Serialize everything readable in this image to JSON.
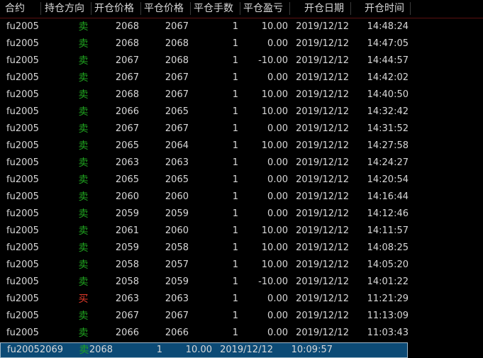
{
  "colors": {
    "background": "#000000",
    "sell": "#1fa51f",
    "buy": "#e23a2a",
    "selected_row": "#0c4a75",
    "text": "#d8d8d8"
  },
  "headers": {
    "contract": "合约",
    "direction": "持仓方向",
    "open_price": "开仓价格",
    "close_price": "平仓价格",
    "close_qty": "平仓手数",
    "close_pl": "平仓盈亏",
    "open_date": "开仓日期",
    "open_time": "开仓时间"
  },
  "rows": [
    {
      "contract": "fu2005",
      "direction": "卖",
      "side": "sell",
      "open_price": "2068",
      "close_price": "2067",
      "qty": "1",
      "pl": "10.00",
      "date": "2019/12/12",
      "time": "14:48:24"
    },
    {
      "contract": "fu2005",
      "direction": "卖",
      "side": "sell",
      "open_price": "2068",
      "close_price": "2068",
      "qty": "1",
      "pl": "0.00",
      "date": "2019/12/12",
      "time": "14:47:05"
    },
    {
      "contract": "fu2005",
      "direction": "卖",
      "side": "sell",
      "open_price": "2067",
      "close_price": "2068",
      "qty": "1",
      "pl": "-10.00",
      "date": "2019/12/12",
      "time": "14:44:57"
    },
    {
      "contract": "fu2005",
      "direction": "卖",
      "side": "sell",
      "open_price": "2067",
      "close_price": "2067",
      "qty": "1",
      "pl": "0.00",
      "date": "2019/12/12",
      "time": "14:42:02"
    },
    {
      "contract": "fu2005",
      "direction": "卖",
      "side": "sell",
      "open_price": "2068",
      "close_price": "2067",
      "qty": "1",
      "pl": "10.00",
      "date": "2019/12/12",
      "time": "14:40:50"
    },
    {
      "contract": "fu2005",
      "direction": "卖",
      "side": "sell",
      "open_price": "2066",
      "close_price": "2065",
      "qty": "1",
      "pl": "10.00",
      "date": "2019/12/12",
      "time": "14:32:42"
    },
    {
      "contract": "fu2005",
      "direction": "卖",
      "side": "sell",
      "open_price": "2067",
      "close_price": "2067",
      "qty": "1",
      "pl": "0.00",
      "date": "2019/12/12",
      "time": "14:31:52"
    },
    {
      "contract": "fu2005",
      "direction": "卖",
      "side": "sell",
      "open_price": "2065",
      "close_price": "2064",
      "qty": "1",
      "pl": "10.00",
      "date": "2019/12/12",
      "time": "14:27:58"
    },
    {
      "contract": "fu2005",
      "direction": "卖",
      "side": "sell",
      "open_price": "2063",
      "close_price": "2063",
      "qty": "1",
      "pl": "0.00",
      "date": "2019/12/12",
      "time": "14:24:27"
    },
    {
      "contract": "fu2005",
      "direction": "卖",
      "side": "sell",
      "open_price": "2065",
      "close_price": "2065",
      "qty": "1",
      "pl": "0.00",
      "date": "2019/12/12",
      "time": "14:20:54"
    },
    {
      "contract": "fu2005",
      "direction": "卖",
      "side": "sell",
      "open_price": "2060",
      "close_price": "2060",
      "qty": "1",
      "pl": "0.00",
      "date": "2019/12/12",
      "time": "14:16:44"
    },
    {
      "contract": "fu2005",
      "direction": "卖",
      "side": "sell",
      "open_price": "2059",
      "close_price": "2059",
      "qty": "1",
      "pl": "0.00",
      "date": "2019/12/12",
      "time": "14:12:46"
    },
    {
      "contract": "fu2005",
      "direction": "卖",
      "side": "sell",
      "open_price": "2061",
      "close_price": "2060",
      "qty": "1",
      "pl": "10.00",
      "date": "2019/12/12",
      "time": "14:11:57"
    },
    {
      "contract": "fu2005",
      "direction": "卖",
      "side": "sell",
      "open_price": "2059",
      "close_price": "2058",
      "qty": "1",
      "pl": "10.00",
      "date": "2019/12/12",
      "time": "14:08:25"
    },
    {
      "contract": "fu2005",
      "direction": "卖",
      "side": "sell",
      "open_price": "2058",
      "close_price": "2057",
      "qty": "1",
      "pl": "10.00",
      "date": "2019/12/12",
      "time": "14:05:20"
    },
    {
      "contract": "fu2005",
      "direction": "卖",
      "side": "sell",
      "open_price": "2058",
      "close_price": "2059",
      "qty": "1",
      "pl": "-10.00",
      "date": "2019/12/12",
      "time": "14:01:22"
    },
    {
      "contract": "fu2005",
      "direction": "买",
      "side": "buy",
      "open_price": "2063",
      "close_price": "2063",
      "qty": "1",
      "pl": "0.00",
      "date": "2019/12/12",
      "time": "11:21:29"
    },
    {
      "contract": "fu2005",
      "direction": "卖",
      "side": "sell",
      "open_price": "2067",
      "close_price": "2067",
      "qty": "1",
      "pl": "0.00",
      "date": "2019/12/12",
      "time": "11:13:09"
    },
    {
      "contract": "fu2005",
      "direction": "卖",
      "side": "sell",
      "open_price": "2066",
      "close_price": "2066",
      "qty": "1",
      "pl": "0.00",
      "date": "2019/12/12",
      "time": "11:03:43"
    },
    {
      "contract": "fu2005",
      "direction": "卖",
      "side": "sell",
      "open_price": "2069",
      "close_price": "2068",
      "qty": "1",
      "pl": "10.00",
      "date": "2019/12/12",
      "time": "10:09:57",
      "selected": true
    }
  ]
}
